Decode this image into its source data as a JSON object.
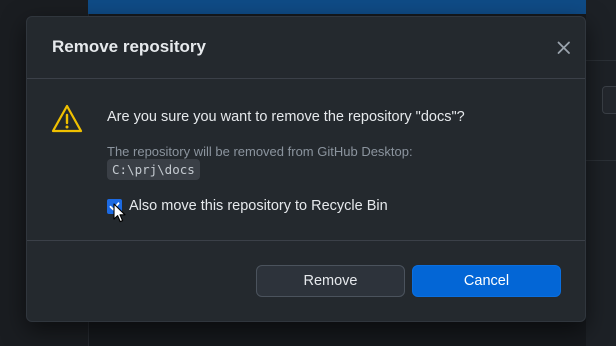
{
  "dialog": {
    "title": "Remove repository",
    "question": "Are you sure you want to remove the repository \"docs\"?",
    "detail": "The repository will be removed from GitHub Desktop:",
    "path": "C:\\prj\\docs",
    "checkbox_label": "Also move this repository to Recycle Bin",
    "checkbox_checked": true,
    "remove_label": "Remove",
    "cancel_label": "Cancel"
  },
  "icons": {
    "close": "close-icon",
    "warning": "warning-icon",
    "check": "checkmark-icon"
  },
  "colors": {
    "accent": "#0366d6",
    "warning": "#f0c000",
    "dialog_bg": "#24292e"
  }
}
